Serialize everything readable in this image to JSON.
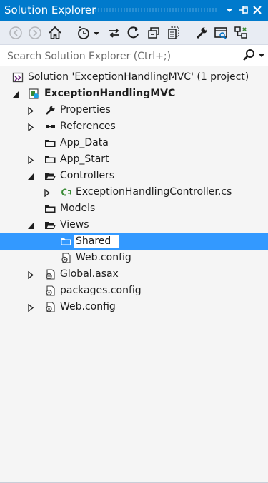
{
  "panel": {
    "title": "Solution Explorer",
    "pin_label": "⊣",
    "close_label": "✕",
    "accent": "#007acc"
  },
  "toolbar": {
    "buttons": [
      {
        "name": "back-icon",
        "enabled": false
      },
      {
        "name": "forward-icon",
        "enabled": false
      },
      {
        "name": "home-icon",
        "enabled": true
      },
      {
        "name": "pending-changes-icon",
        "enabled": true
      },
      {
        "name": "sync-with-document-icon",
        "enabled": true
      },
      {
        "name": "refresh-icon",
        "enabled": true
      },
      {
        "name": "collapse-all-icon",
        "enabled": true
      },
      {
        "name": "show-all-files-icon",
        "enabled": true
      },
      {
        "name": "properties-icon",
        "enabled": true
      },
      {
        "name": "preview-icon",
        "enabled": true
      },
      {
        "name": "view-class-diagram-icon",
        "enabled": true
      }
    ]
  },
  "search": {
    "placeholder": "Search Solution Explorer (Ctrl+;)",
    "value": ""
  },
  "tree": {
    "solution_label": "Solution 'ExceptionHandlingMVC' (1 project)",
    "project_label": "ExceptionHandlingMVC",
    "properties_label": "Properties",
    "references_label": "References",
    "app_data_label": "App_Data",
    "app_start_label": "App_Start",
    "controllers_label": "Controllers",
    "controller_file_label": "ExceptionHandlingController.cs",
    "models_label": "Models",
    "views_label": "Views",
    "shared_label": "Shared",
    "views_webconfig_label": "Web.config",
    "global_label": "Global.asax",
    "packages_label": "packages.config",
    "root_webconfig_label": "Web.config",
    "selection_color": "#3399ff"
  }
}
